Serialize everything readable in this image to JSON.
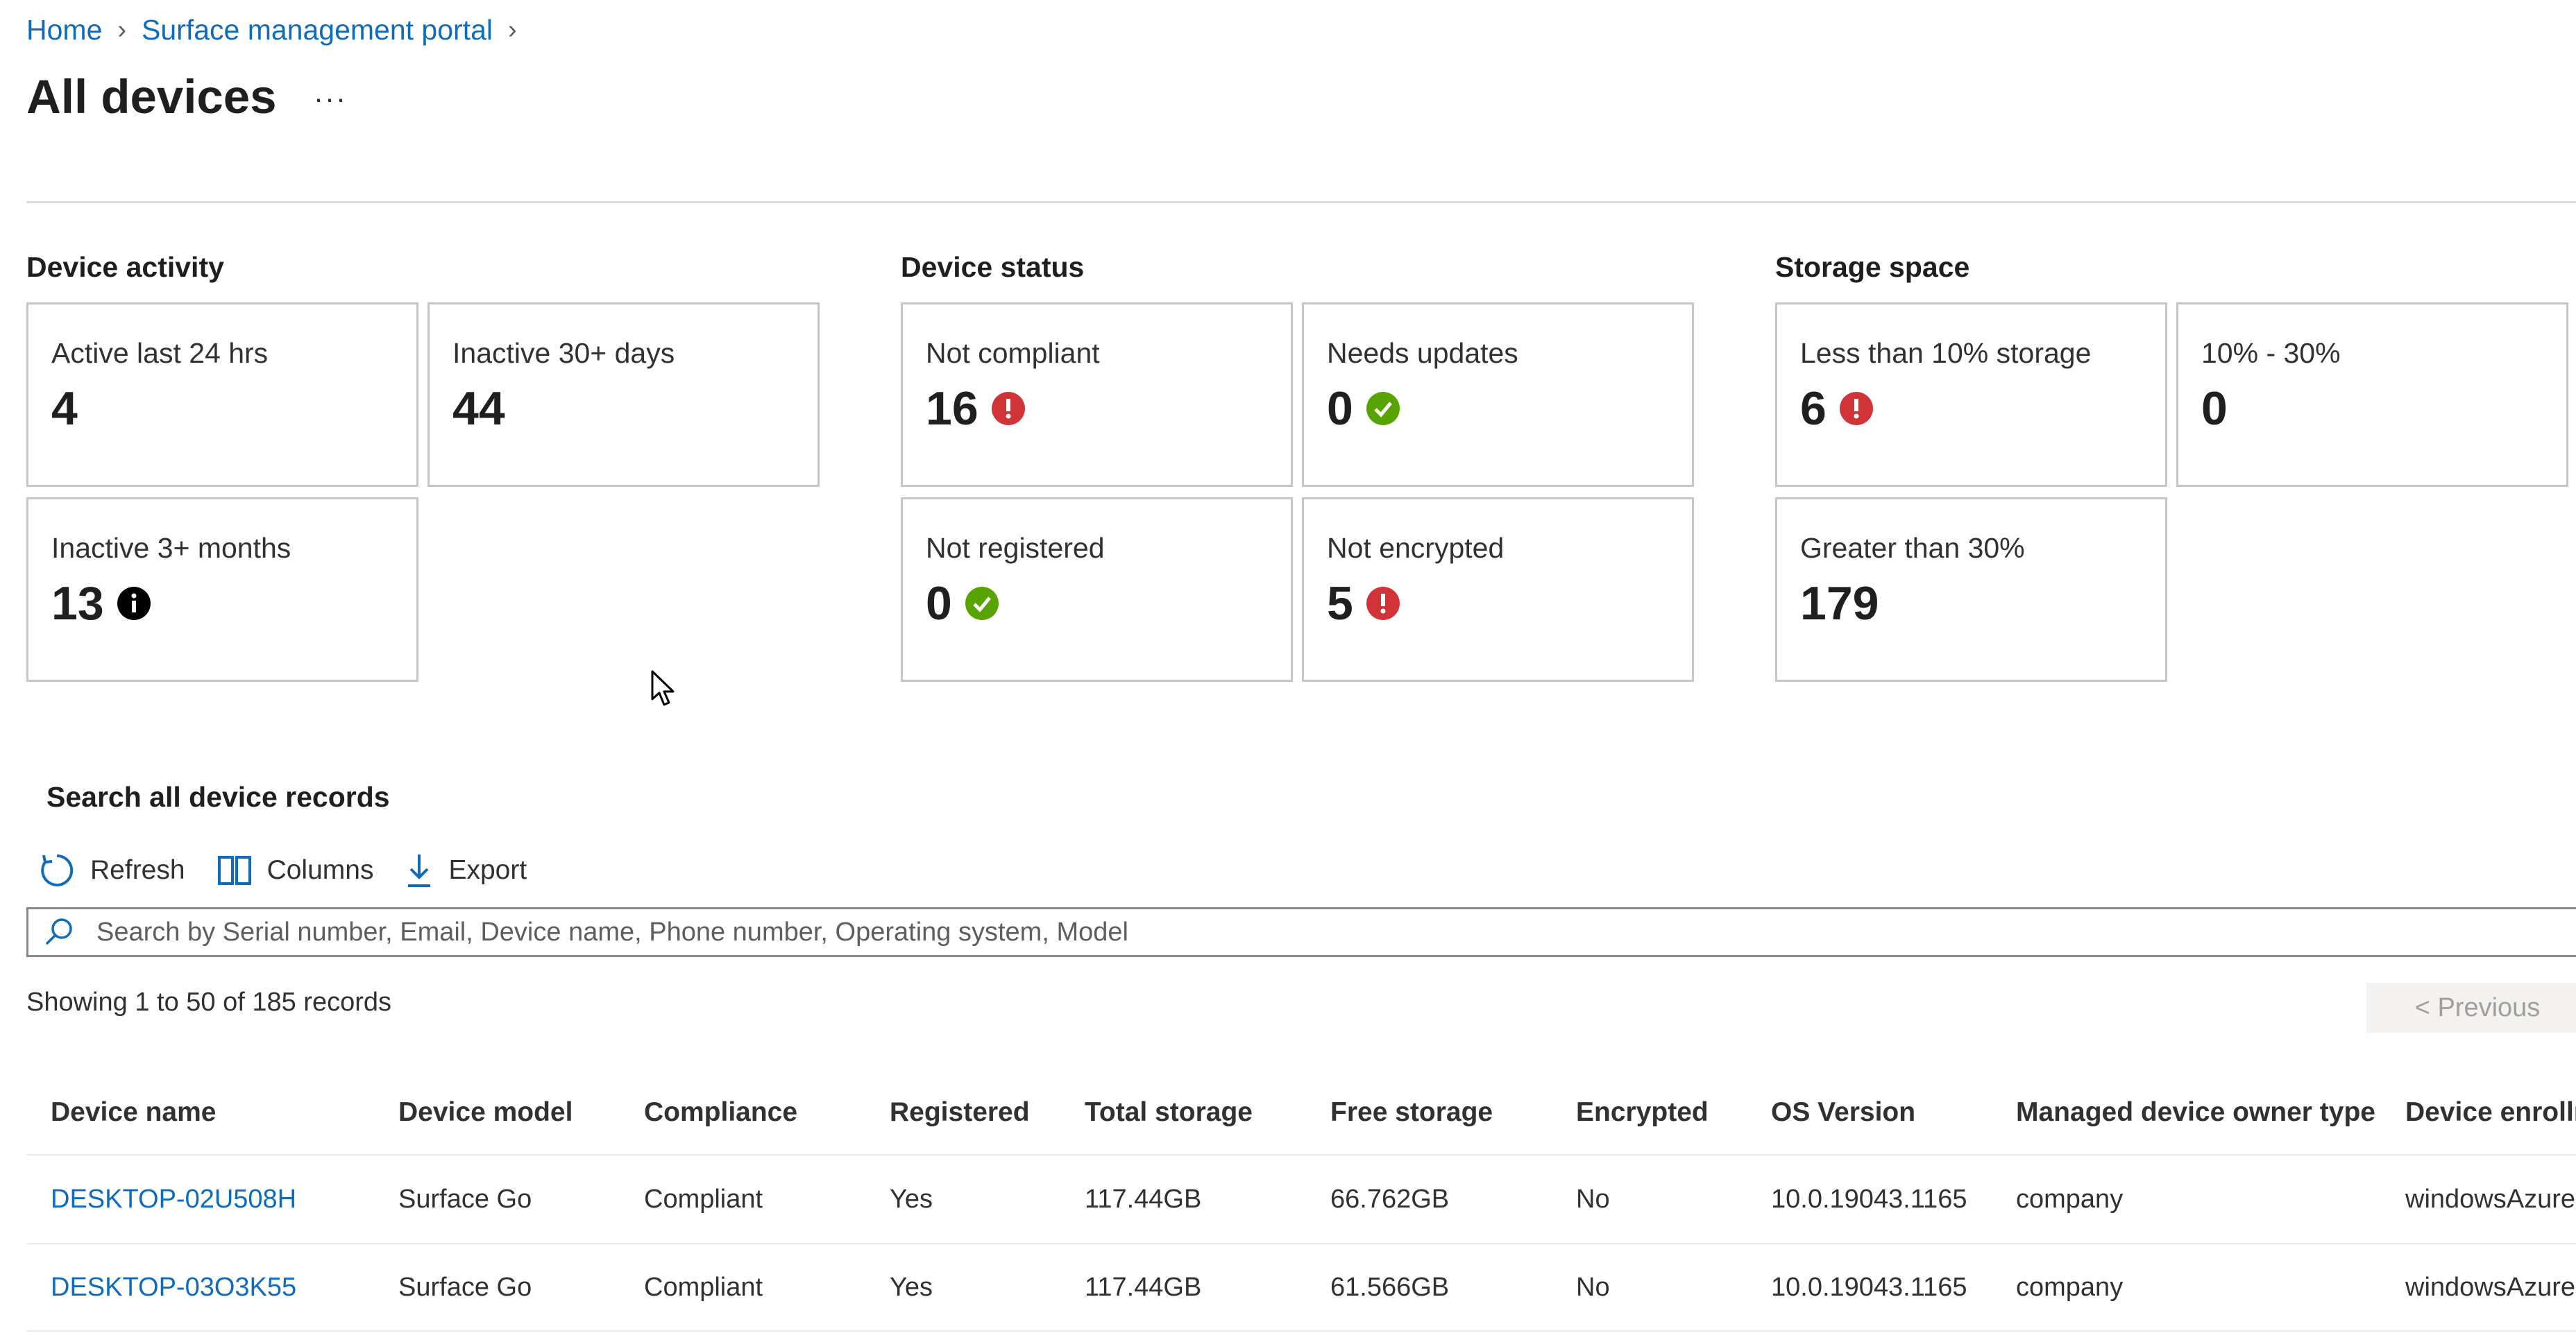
{
  "breadcrumb": {
    "home": "Home",
    "portal": "Surface management portal"
  },
  "page": {
    "title": "All devices",
    "more": "···"
  },
  "sections": {
    "activity": {
      "title": "Device activity",
      "cards": [
        {
          "label": "Active last 24 hrs",
          "value": "4",
          "status": "none"
        },
        {
          "label": "Inactive 30+ days",
          "value": "44",
          "status": "none"
        },
        {
          "label": "Inactive 3+ months",
          "value": "13",
          "status": "info"
        }
      ]
    },
    "status": {
      "title": "Device status",
      "cards": [
        {
          "label": "Not compliant",
          "value": "16",
          "status": "error"
        },
        {
          "label": "Needs updates",
          "value": "0",
          "status": "success"
        },
        {
          "label": "Not registered",
          "value": "0",
          "status": "success"
        },
        {
          "label": "Not encrypted",
          "value": "5",
          "status": "error"
        }
      ]
    },
    "storage": {
      "title": "Storage space",
      "cards": [
        {
          "label": "Less than 10% storage",
          "value": "6",
          "status": "error"
        },
        {
          "label": "10% - 30%",
          "value": "0",
          "status": "none"
        },
        {
          "label": "Greater than 30%",
          "value": "179",
          "status": "none"
        }
      ]
    }
  },
  "search": {
    "title": "Search all device records",
    "placeholder": "Search by Serial number, Email, Device name, Phone number, Operating system, Model"
  },
  "toolbar": {
    "refresh": "Refresh",
    "columns": "Columns",
    "export": "Export"
  },
  "pagination": {
    "summary": "Showing 1 to 50 of 185 records",
    "previous": "< Previous"
  },
  "table": {
    "columns": [
      "Device name",
      "Device model",
      "Compliance",
      "Registered",
      "Total storage",
      "Free storage",
      "Encrypted",
      "OS Version",
      "Managed device owner type",
      "Device enrollm"
    ],
    "rows": [
      [
        "DESKTOP-02U508H",
        "Surface Go",
        "Compliant",
        "Yes",
        "117.44GB",
        "66.762GB",
        "No",
        "10.0.19043.1165",
        "company",
        "windowsAzure"
      ],
      [
        "DESKTOP-03O3K55",
        "Surface Go",
        "Compliant",
        "Yes",
        "117.44GB",
        "61.566GB",
        "No",
        "10.0.19043.1165",
        "company",
        "windowsAzure"
      ]
    ]
  },
  "colors": {
    "link": "#0f6cbd",
    "error": "#d13438",
    "success": "#57a300",
    "info": "#000000"
  }
}
